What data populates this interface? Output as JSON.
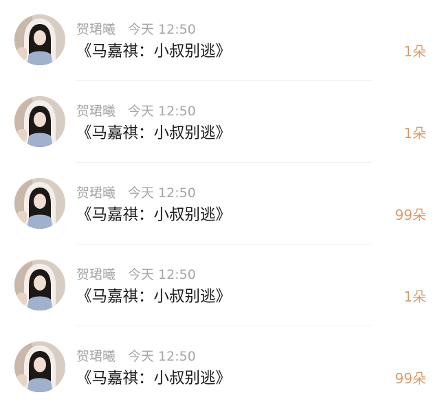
{
  "gifts": [
    {
      "user": "贺珺曦",
      "time": "今天 12:50",
      "title": "《马嘉祺：小叔别逃》",
      "amount": "1朵"
    },
    {
      "user": "贺珺曦",
      "time": "今天 12:50",
      "title": "《马嘉祺：小叔别逃》",
      "amount": "1朵"
    },
    {
      "user": "贺珺曦",
      "time": "今天 12:50",
      "title": "《马嘉祺：小叔别逃》",
      "amount": "99朵"
    },
    {
      "user": "贺珺曦",
      "time": "今天 12:50",
      "title": "《马嘉祺：小叔别逃》",
      "amount": "1朵"
    },
    {
      "user": "贺珺曦",
      "time": "今天 12:50",
      "title": "《马嘉祺：小叔别逃》",
      "amount": "99朵"
    }
  ],
  "colors": {
    "username": "#a6a6a6",
    "time": "#a6a6a6",
    "title": "#1a1a1a",
    "amount": "#d99a67",
    "divider": "#f0f0f0"
  }
}
